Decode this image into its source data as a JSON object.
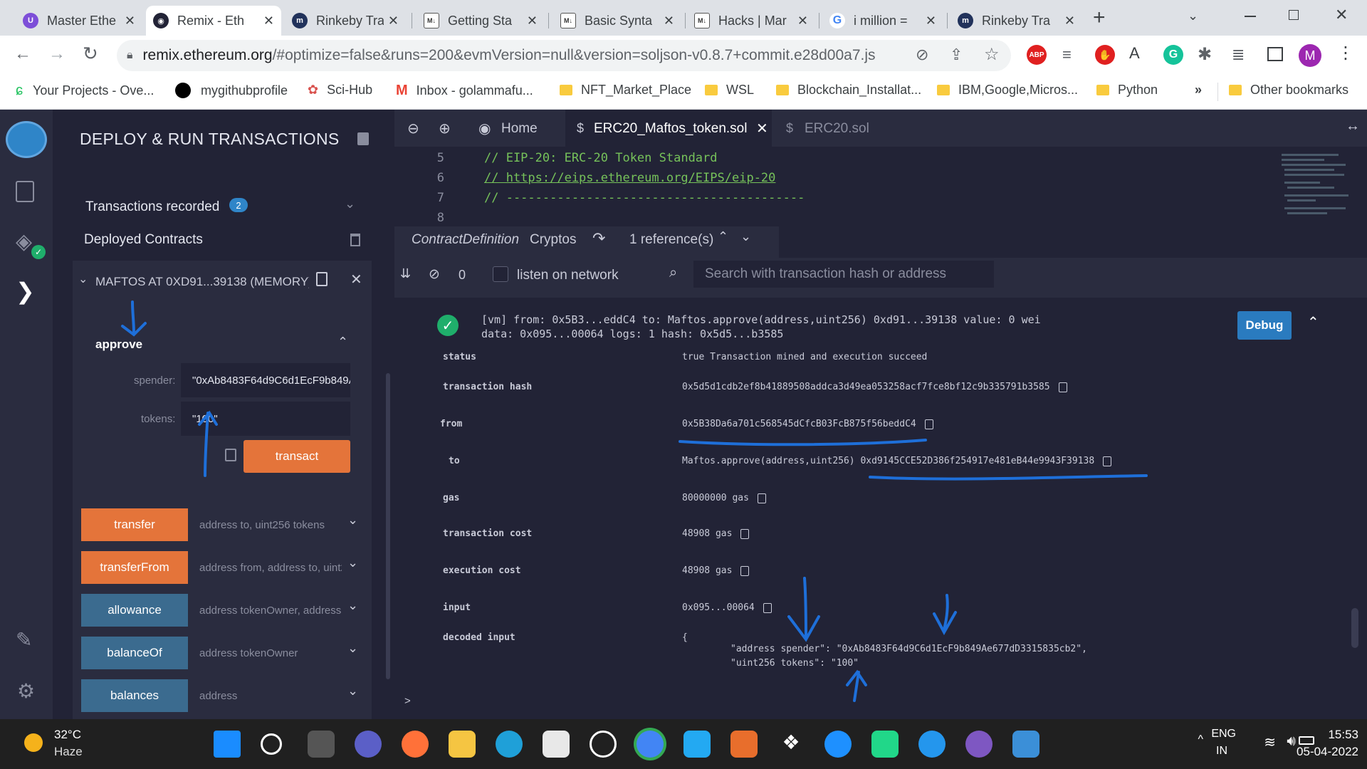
{
  "browser": {
    "tabs": [
      {
        "title": "Master Ethe",
        "color": "#7d4ed8"
      },
      {
        "title": "Remix - Eth",
        "color": "#222336",
        "active": true
      },
      {
        "title": "Rinkeby Tra",
        "color": "#21325b"
      },
      {
        "title": "Getting Sta",
        "color": "#3c4043"
      },
      {
        "title": "Basic Synta",
        "color": "#3c4043"
      },
      {
        "title": "Hacks | Mar",
        "color": "#3c4043"
      },
      {
        "title": "i million =",
        "color": "#4285f4"
      },
      {
        "title": "Rinkeby Tra",
        "color": "#21325b"
      }
    ],
    "url_host": "remix.ethereum.org",
    "url_rest": "/#optimize=false&runs=200&evmVersion=null&version=soljson-v0.8.7+commit.e28d00a7.js",
    "bookmarks": [
      "Your Projects - Ove...",
      "mygithubprofile",
      "Sci-Hub",
      "Inbox - golammafu...",
      "NFT_Market_Place",
      "WSL",
      "Blockchain_Installat...",
      "IBM,Google,Micros...",
      "Python"
    ],
    "other_bookmarks": "Other bookmarks",
    "profile_initial": "M"
  },
  "sidepanel": {
    "title": "DEPLOY & RUN TRANSACTIONS",
    "transactions_recorded": "Transactions recorded",
    "transactions_count": "2",
    "deployed_contracts": "Deployed Contracts",
    "contract_instance": "MAFTOS AT 0XD91...39138 (MEMORY)",
    "approve_label": "approve",
    "spender_label": "spender:",
    "spender_value": "\"0xAb8483F64d9C6d1EcF9b849Ae677dD3315835cb2\"",
    "tokens_label": "tokens:",
    "tokens_value": "\"100\"",
    "transact_label": "transact",
    "functions": [
      {
        "name": "transfer",
        "placeholder": "address to, uint256 tokens",
        "kind": "orange"
      },
      {
        "name": "transferFrom",
        "placeholder": "address from, address to, uint256 tokens",
        "kind": "orange"
      },
      {
        "name": "allowance",
        "placeholder": "address tokenOwner, address spender",
        "kind": "blue"
      },
      {
        "name": "balanceOf",
        "placeholder": "address tokenOwner",
        "kind": "blue"
      },
      {
        "name": "balances",
        "placeholder": "address",
        "kind": "blue"
      }
    ]
  },
  "editor": {
    "tabs": [
      "Home",
      "ERC20_Maftos_token.sol",
      "ERC20.sol"
    ],
    "lines": [
      {
        "num": "5",
        "text": "// EIP-20: ERC-20 Token Standard"
      },
      {
        "num": "6",
        "text": "// https://eips.ethereum.org/EIPS/eip-20"
      },
      {
        "num": "7",
        "text": "// -----------------------------------------"
      },
      {
        "num": "8",
        "text": ""
      }
    ],
    "context_kind": "ContractDefinition",
    "context_name": "Cryptos",
    "references": "1 reference(s)"
  },
  "terminal": {
    "count": "0",
    "listen_label": "listen on network",
    "search_placeholder": "Search with transaction hash or address",
    "summary_line1_prefix": "[vm]",
    "summary_line1": "from: 0x5B3...eddC4 to: Maftos.approve(address,uint256) 0xd91...39138 value: 0 wei",
    "summary_line2": "data: 0x095...00064 logs: 1 hash: 0x5d5...b3585",
    "debug_label": "Debug",
    "rows": [
      {
        "label": "status",
        "value": "true Transaction mined and execution succeed"
      },
      {
        "label": "transaction hash",
        "value": "0x5d5d1cdb2ef8b41889508addca3d49ea053258acf7fce8bf12c9b335791b3585"
      },
      {
        "label": "from",
        "value": "0x5B38Da6a701c568545dCfcB03FcB875f56beddC4"
      },
      {
        "label": "to",
        "value": "Maftos.approve(address,uint256) 0xd9145CCE52D386f254917e481eB44e9943F39138"
      },
      {
        "label": "gas",
        "value": "80000000 gas"
      },
      {
        "label": "transaction cost",
        "value": "48908 gas"
      },
      {
        "label": "execution cost",
        "value": "48908 gas"
      },
      {
        "label": "input",
        "value": "0x095...00064"
      },
      {
        "label": "decoded input",
        "value": "{"
      }
    ],
    "decoded_line1": "\"address spender\": \"0xAb8483F64d9C6d1EcF9b849Ae677dD3315835cb2\",",
    "decoded_line2": "\"uint256 tokens\": \"100\"",
    "prompt": ">"
  },
  "taskbar": {
    "temperature": "32°C",
    "weather": "Haze",
    "lang1": "ENG",
    "lang2": "IN",
    "time": "15:53",
    "date": "05-04-2022"
  },
  "colors": {
    "remix_bg": "#222336",
    "accent_orange": "#e4743a",
    "accent_blue": "#3b6b8f",
    "success_green": "#1fae6b",
    "annotation_blue": "#1e6fd9"
  }
}
